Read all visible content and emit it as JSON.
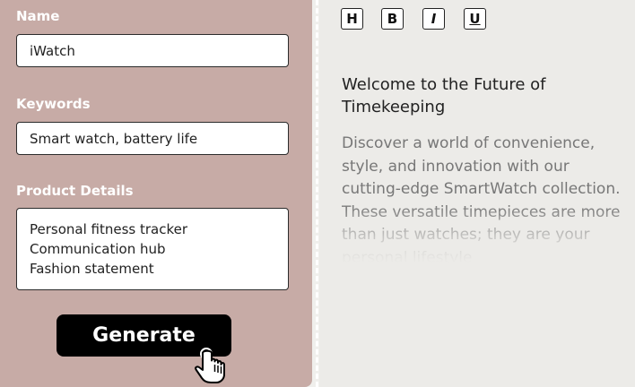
{
  "form": {
    "name_label": "Name",
    "name_value": "iWatch",
    "keywords_label": "Keywords",
    "keywords_value": "Smart watch, battery life",
    "details_label": "Product Details",
    "details_lines": [
      "Personal fitness tracker",
      "Communication hub",
      "Fashion statement"
    ],
    "generate_label": "Generate"
  },
  "toolbar": {
    "heading_btn": "H",
    "bold_btn": "B",
    "italic_btn": "I",
    "underline_btn": "U"
  },
  "output": {
    "heading": "Welcome to the Future of Timekeeping",
    "body": "Discover a world of convenience, style, and innovation with our cutting-edge SmartWatch collection. These versatile timepieces are more than just watches; they are your personal lifestyle"
  },
  "colors": {
    "left_panel": "#c7aba6",
    "right_panel": "#ecebe8",
    "button": "#000000"
  },
  "icons": {
    "cursor": "hand-pointer-icon"
  }
}
